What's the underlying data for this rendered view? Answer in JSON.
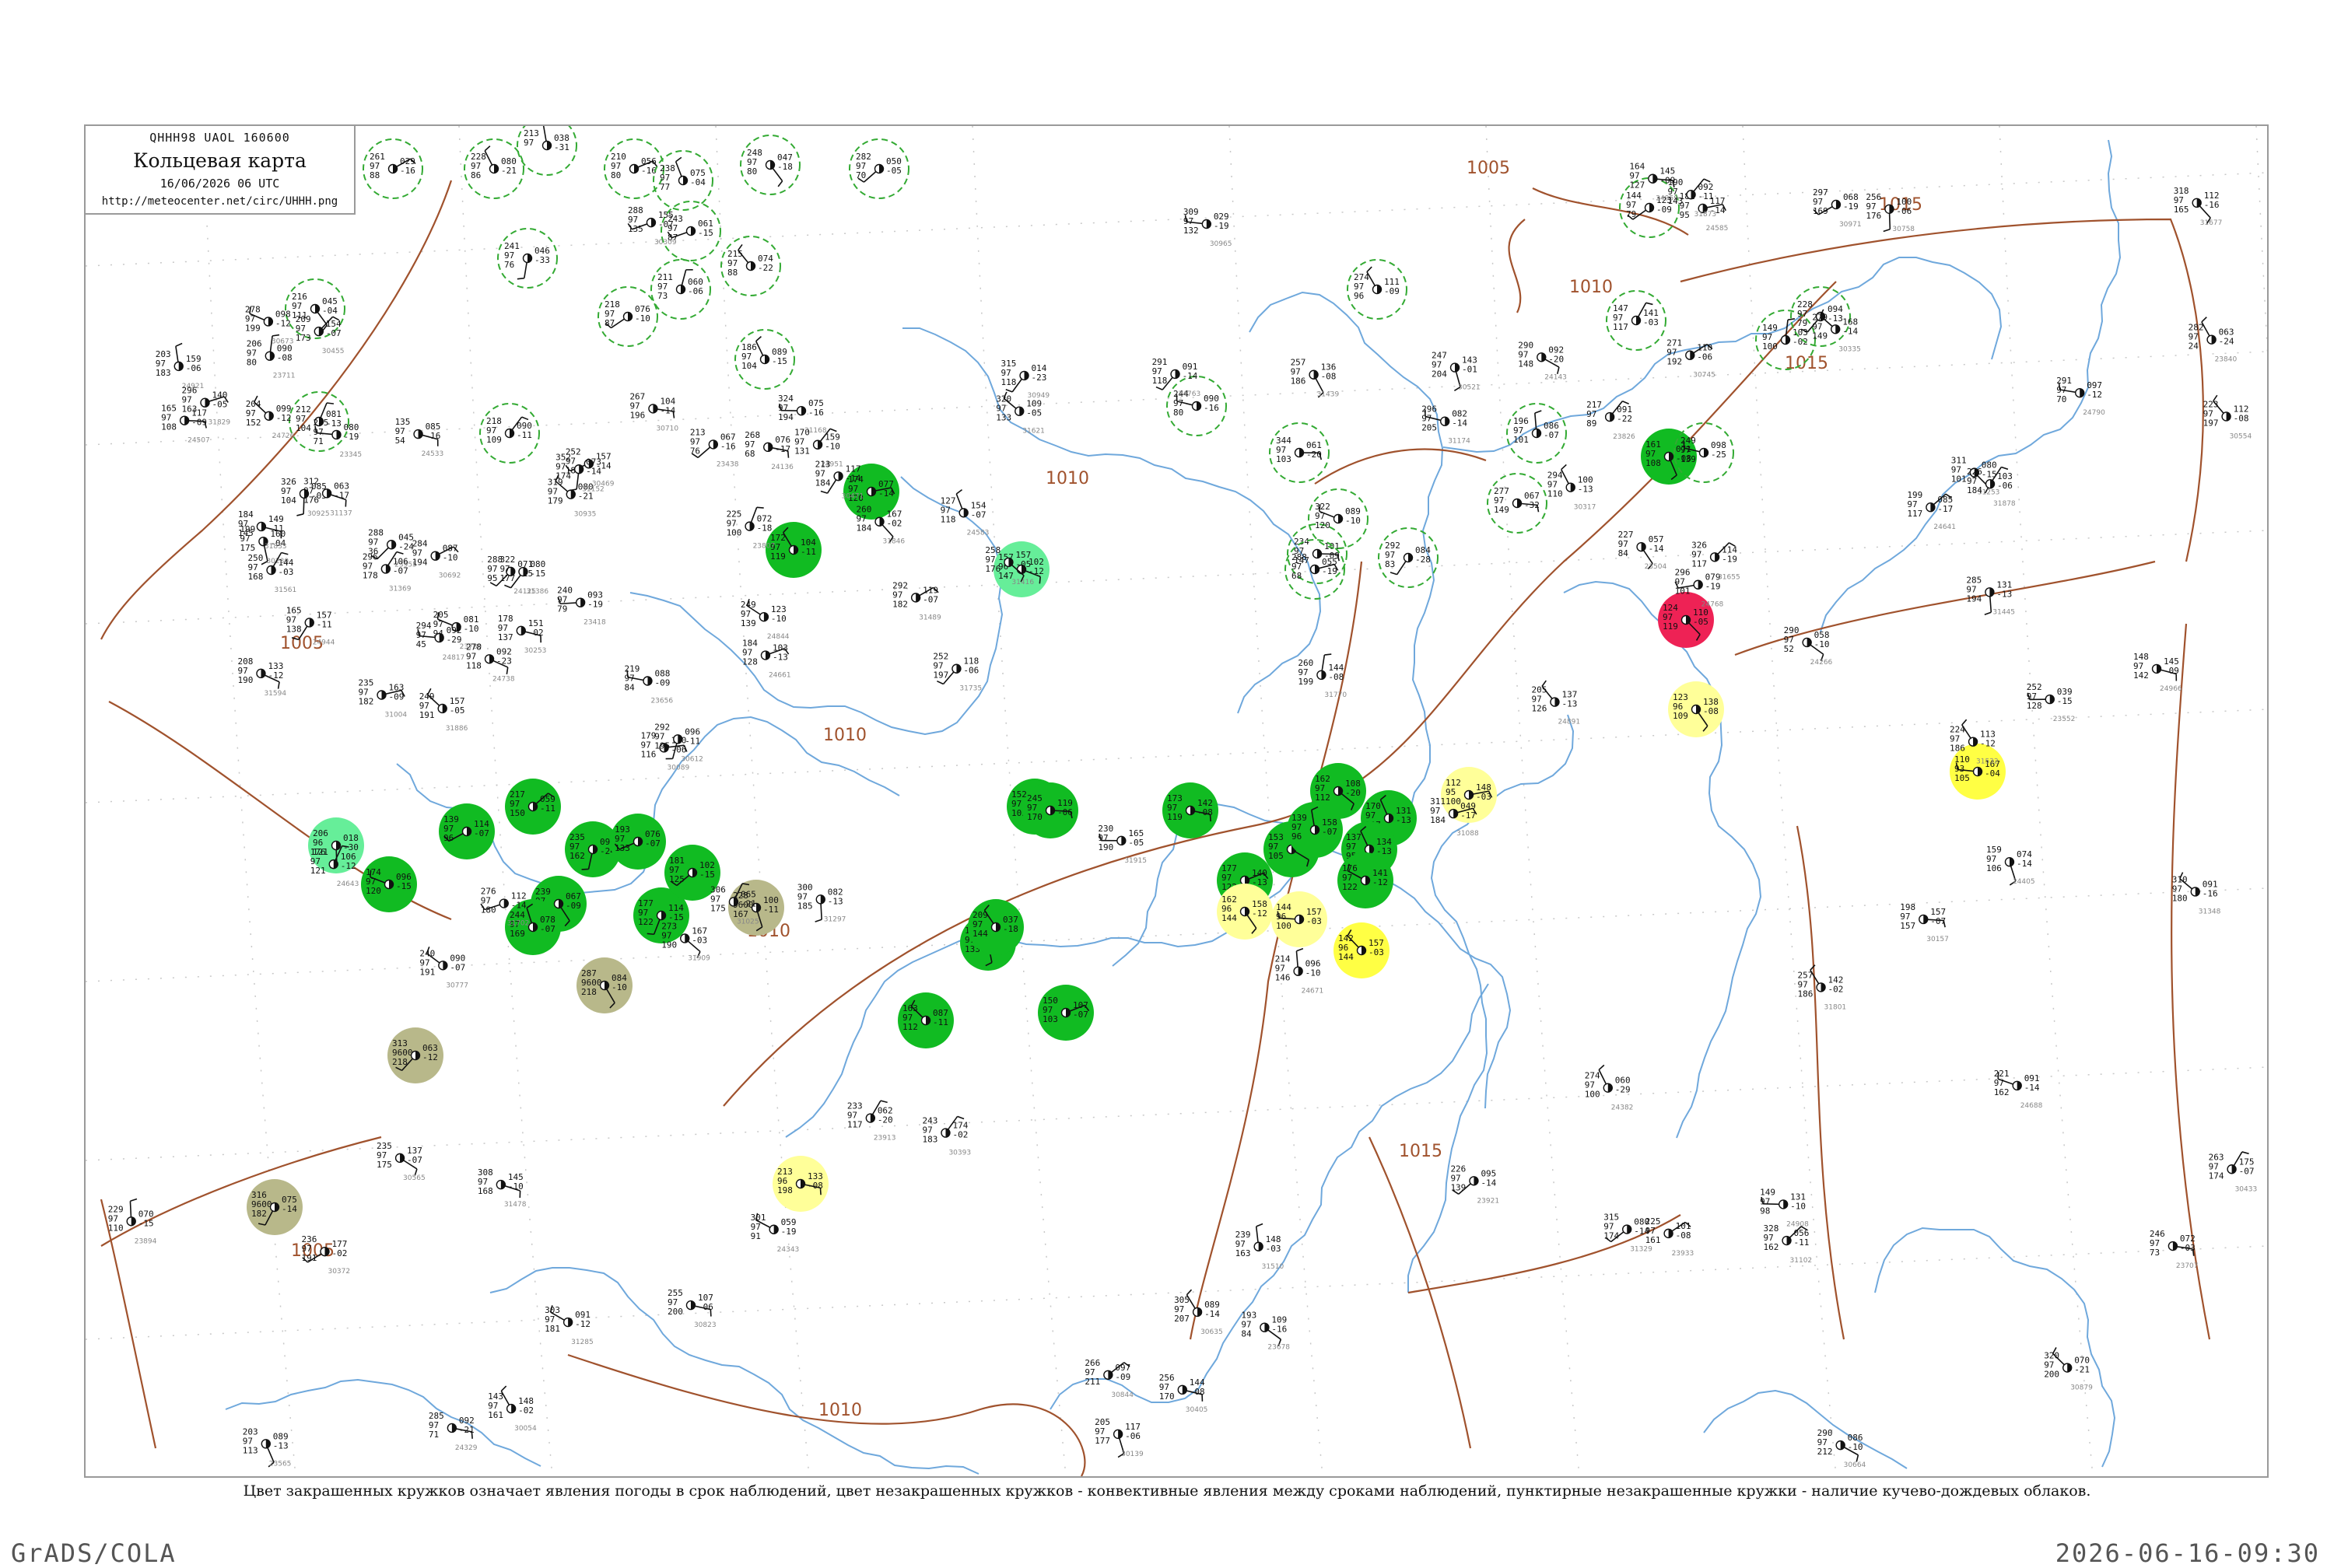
{
  "header": {
    "codes": "QHHH98  UAOL  160600",
    "title": "Кольцевая карта",
    "date": "16/06/2026 06 UTC",
    "url": "http://meteocenter.net/circ/UHHH.png"
  },
  "caption": "Цвет закрашенных кружков означает явления погоды в срок наблюдений, цвет незакрашенных кружков - конвективные явления между сроками наблюдений, пунктирные незакрашенные кружки - наличие кучево-дождевых облаков.",
  "footer": {
    "left": "GrADS/COLA",
    "right": "2026-06-16-09:30"
  },
  "colors": {
    "isobar": "#a0522d",
    "river": "#6fa8dc",
    "green_fill": "#11bb22",
    "light_green_fill": "#66ee99",
    "yellow_fill": "#ffff44",
    "pale_yellow_fill": "#ffff99",
    "olive_fill": "#b8b88a",
    "red_fill": "#ee2255",
    "cb_ring": "#33aa33"
  },
  "isobars": [
    {
      "label": "1005",
      "lx": 0.089,
      "ly": 0.387
    },
    {
      "label": "1005",
      "lx": 0.633,
      "ly": 0.035
    },
    {
      "label": "1010",
      "lx": 0.44,
      "ly": 0.265
    },
    {
      "label": "1010",
      "lx": 0.338,
      "ly": 0.455
    },
    {
      "label": "1010",
      "lx": 0.303,
      "ly": 0.6
    },
    {
      "label": "1010",
      "lx": 0.68,
      "ly": 0.123
    },
    {
      "label": "1015",
      "lx": 0.822,
      "ly": 0.062
    },
    {
      "label": "1015",
      "lx": 0.779,
      "ly": 0.18
    },
    {
      "label": "1015",
      "lx": 0.602,
      "ly": 0.763
    },
    {
      "label": "1010",
      "lx": 0.336,
      "ly": 0.955
    },
    {
      "label": "1005",
      "lx": 0.094,
      "ly": 0.837
    }
  ],
  "stations": {
    "filled": [
      {
        "c": "green",
        "t": "172 97 119",
        "p": "104 -11"
      },
      {
        "c": "green",
        "t": "161 97 108",
        "p": "071 -08"
      },
      {
        "c": "green",
        "t": "174 97 120",
        "p": "077 -14"
      },
      {
        "c": "green",
        "t": "217 97 150",
        "p": "059 -11"
      },
      {
        "c": "green",
        "t": "174 97 120",
        "p": "096 -15"
      },
      {
        "c": "green",
        "t": "239 97 165",
        "p": "067 -09"
      },
      {
        "c": "green",
        "t": "139 97 96",
        "p": "114 -07"
      },
      {
        "c": "green",
        "t": "244 97 169",
        "p": "078 -07"
      },
      {
        "c": "green",
        "t": "235 97 162",
        "p": "094 -24"
      },
      {
        "c": "green",
        "t": "193 97 133",
        "p": "076 -07"
      },
      {
        "c": "green",
        "t": "177 97 122",
        "p": "114 -15"
      },
      {
        "c": "green",
        "t": "181 97 125",
        "p": "102 -15"
      },
      {
        "c": "green",
        "t": "152 97 105",
        "p": "082 -16"
      },
      {
        "c": "green",
        "t": "245 97 170",
        "p": "119 -06"
      },
      {
        "c": "green",
        "t": "192 97 133",
        "p": "103 -14"
      },
      {
        "c": "green",
        "t": "163 97 112",
        "p": "087 -11"
      },
      {
        "c": "green",
        "t": "209 97 144",
        "p": "037 -18"
      },
      {
        "c": "green",
        "t": "173 97 119",
        "p": "142 -08"
      },
      {
        "c": "green",
        "t": "177 97 122",
        "p": "140 -13"
      },
      {
        "c": "green",
        "t": "153 97 105",
        "p": "110 -13"
      },
      {
        "c": "green",
        "t": "162 97 112",
        "p": "108 -20"
      },
      {
        "c": "green",
        "t": "139 97 96",
        "p": "158 -07"
      },
      {
        "c": "green",
        "t": "170 97 117",
        "p": "131 -13"
      },
      {
        "c": "green",
        "t": "137 97 95",
        "p": "134 -13"
      },
      {
        "c": "green",
        "t": "176 97 122",
        "p": "141 -12"
      },
      {
        "c": "green",
        "t": "150 97 103",
        "p": "107 -07"
      },
      {
        "c": "light_green",
        "t": "157 96 147",
        "p": "102 -12"
      },
      {
        "c": "light_green",
        "t": "206 96 121",
        "p": "018 -30"
      },
      {
        "c": "olive",
        "t": "287 9600 218",
        "p": "084 -10"
      },
      {
        "c": "olive",
        "t": "313 9600 218",
        "p": "063 -12"
      },
      {
        "c": "olive",
        "t": "316 9600 182",
        "p": "075 -14"
      },
      {
        "c": "olive",
        "t": "228 9600 167",
        "p": "100 -11"
      },
      {
        "c": "pale_yellow",
        "t": "213 96 198",
        "p": "133 -08"
      },
      {
        "c": "pale_yellow",
        "t": "162 96 144",
        "p": "158 -12"
      },
      {
        "c": "pale_yellow",
        "t": "144 96 100",
        "p": "157 -03"
      },
      {
        "c": "pale_yellow",
        "t": "112 95 100",
        "p": "148 -03"
      },
      {
        "c": "pale_yellow",
        "t": "123 96 109",
        "p": "138 -08"
      },
      {
        "c": "yellow",
        "t": "110 93 105",
        "p": "167 -04"
      },
      {
        "c": "yellow",
        "t": "142 96 144",
        "p": "157 -03"
      },
      {
        "c": "red",
        "t": "124 97 119",
        "p": "110 -05"
      }
    ],
    "dashed": [
      {
        "t": "261 97 88",
        "p": "029 -16"
      },
      {
        "t": "228 97 86",
        "p": "080 -21"
      },
      {
        "t": "213 97",
        "p": "038 -31"
      },
      {
        "t": "210 97 80",
        "p": "056 -16"
      },
      {
        "t": "238 97 77",
        "p": "075 -04"
      },
      {
        "t": "248 97 80",
        "p": "047 -18"
      },
      {
        "t": "282 97 70",
        "p": "050 -05"
      },
      {
        "t": "243 97 87",
        "p": "061 -15"
      },
      {
        "t": "241 97 76",
        "p": "046 -33"
      },
      {
        "t": "216 97 111",
        "p": "045 -04"
      },
      {
        "t": "218 97 87",
        "p": "076 -10"
      },
      {
        "t": "211 97 73",
        "p": "060 -06"
      },
      {
        "t": "215 97 88",
        "p": "074 -22"
      },
      {
        "t": "186 97 104",
        "p": "089 -15"
      },
      {
        "t": "212 97 104",
        "p": "081 -13"
      },
      {
        "t": "218 97 109",
        "p": "090 -11"
      },
      {
        "t": "244 97 80",
        "p": "090 -16"
      },
      {
        "t": "234 97 147",
        "p": "101 -09"
      },
      {
        "t": "292 97 83",
        "p": "084 -28"
      },
      {
        "t": "288 97 68",
        "p": "055 -19"
      },
      {
        "t": "274 97 96",
        "p": "111 -09"
      },
      {
        "t": "196 97 101",
        "p": "086 -07"
      },
      {
        "t": "147 97 117",
        "p": "141 -03"
      },
      {
        "t": "144 97 79",
        "p": "123 -09"
      },
      {
        "t": "149 97 100",
        "p": "103 -02"
      },
      {
        "t": "228 97 79",
        "p": "094 -13"
      },
      {
        "t": "249 97 139",
        "p": "098 -25"
      },
      {
        "t": "277 97 149",
        "p": "067 -32"
      },
      {
        "t": "322 97 120",
        "p": "089 -10"
      },
      {
        "t": "344 97 103",
        "p": "061 -20"
      }
    ],
    "plain": [
      {
        "t": "285 97 71",
        "p": "080 -19",
        "id": "23345"
      },
      {
        "t": "240 97 79",
        "p": "093 -19",
        "id": "23418"
      },
      {
        "t": "213 97 76",
        "p": "067 -16",
        "id": "23438"
      },
      {
        "t": "227 97 84",
        "p": "057 -14",
        "id": "23504"
      },
      {
        "t": "252 97 128",
        "p": "039 -15",
        "id": "23552"
      },
      {
        "t": "203 97 113",
        "p": "089 -13",
        "id": "23565"
      },
      {
        "t": "219 97 84",
        "p": "088 -09",
        "id": "23656"
      },
      {
        "t": "193 97 84",
        "p": "109 -16",
        "id": "23678"
      },
      {
        "t": "246 97 73",
        "p": "072 -03",
        "id": "23707"
      },
      {
        "t": "206 97 80",
        "p": "090 -08",
        "id": "23711"
      },
      {
        "t": "205 97 94",
        "p": "081 -10",
        "id": "23780"
      },
      {
        "t": "225 97 100",
        "p": "072 -18",
        "id": "23807"
      },
      {
        "t": "217 97 89",
        "p": "091 -22",
        "id": "23826"
      },
      {
        "t": "282 97 24",
        "p": "063 -24",
        "id": "23840"
      },
      {
        "t": "229 97 110",
        "p": "070 -15",
        "id": "23894"
      },
      {
        "t": "233 97 117",
        "p": "062 -20",
        "id": "23913"
      },
      {
        "t": "226 97 139",
        "p": "095 -14",
        "id": "23921"
      },
      {
        "t": "225 97 161",
        "p": "101 -08",
        "id": "23933"
      },
      {
        "t": "288 97 36",
        "p": "045 -24",
        "id": "23955"
      },
      {
        "t": "288 97 95",
        "p": "071 -15",
        "id": "24125"
      },
      {
        "t": "268 97 68",
        "p": "076 -17",
        "id": "24136"
      },
      {
        "t": "290 97 148",
        "p": "092 -20",
        "id": "24143"
      },
      {
        "t": "290 97 52",
        "p": "058 -10",
        "id": "24266"
      },
      {
        "t": "285 97 71",
        "p": "092 -21",
        "id": "24329"
      },
      {
        "t": "301 97 91",
        "p": "059 -19",
        "id": "24343"
      },
      {
        "t": "274 97 100",
        "p": "060 -29",
        "id": "24382"
      },
      {
        "t": "159 97 106",
        "p": "074 -14",
        "id": "24405"
      },
      {
        "t": "165 97 108",
        "p": "117 -09",
        "id": "24507"
      },
      {
        "t": "135 97 54",
        "p": "085 -16",
        "id": "24533"
      },
      {
        "t": "127 97 118",
        "p": "154 -07",
        "id": "24583"
      },
      {
        "t": "181 97 95",
        "p": "117 -14",
        "id": "24585"
      },
      {
        "t": "199 97 117",
        "p": "085 -17",
        "id": "24641"
      },
      {
        "t": "176 97 121",
        "p": "106 -12",
        "id": "24643"
      },
      {
        "t": "184 97 128",
        "p": "103 -13",
        "id": "24661"
      },
      {
        "t": "214 97 146",
        "p": "096 -10",
        "id": "24671"
      },
      {
        "t": "221 97 162",
        "p": "091 -14",
        "id": "24688"
      },
      {
        "t": "204 97 152",
        "p": "099 -12",
        "id": "24726"
      },
      {
        "t": "278 97 118",
        "p": "092 -23",
        "id": "24738"
      },
      {
        "t": "291 97 118",
        "p": "091 -14",
        "id": "24763"
      },
      {
        "t": "296 97 101",
        "p": "079 -19",
        "id": "24768"
      },
      {
        "t": "291 97 70",
        "p": "097 -12",
        "id": "24790"
      },
      {
        "t": "294 97 45",
        "p": "092 -29",
        "id": "24817"
      },
      {
        "t": "249 97 139",
        "p": "123 -10",
        "id": "24844"
      },
      {
        "t": "205 97 126",
        "p": "137 -13",
        "id": "24891"
      },
      {
        "t": "149 97 98",
        "p": "131 -10",
        "id": "24908"
      },
      {
        "t": "203 97 183",
        "p": "159 -06",
        "id": "24921"
      },
      {
        "t": "165 97 138",
        "p": "157 -11",
        "id": "24944"
      },
      {
        "t": "170 97 131",
        "p": "159 -10",
        "id": "24951"
      },
      {
        "t": "164 97 127",
        "p": "145 -09",
        "id": "24959"
      },
      {
        "t": "148 97 142",
        "p": "145 -09",
        "id": "24966"
      },
      {
        "t": "143 97 161",
        "p": "148 -02",
        "id": "30054"
      },
      {
        "t": "179 97 116",
        "p": "150 -06",
        "id": "30089"
      },
      {
        "t": "205 97 177",
        "p": "117 -06",
        "id": "30139"
      },
      {
        "t": "198 97 157",
        "p": "157 -07",
        "id": "30157"
      },
      {
        "t": "199 97 175",
        "p": "160 -04",
        "id": "30230"
      },
      {
        "t": "178 97 137",
        "p": "151 -02",
        "id": "30253"
      },
      {
        "t": "288 97 135",
        "p": "155 -07",
        "id": "30309"
      },
      {
        "t": "294 97 110",
        "p": "100 -13",
        "id": "30317"
      },
      {
        "t": "279 97 149",
        "p": "168 -14",
        "id": "30335"
      },
      {
        "t": "236 97 191",
        "p": "177 -02",
        "id": "30372"
      },
      {
        "t": "243 97 183",
        "p": "174 -02",
        "id": "30393"
      },
      {
        "t": "256 97 170",
        "p": "144 -08",
        "id": "30405"
      },
      {
        "t": "263 97 174",
        "p": "175 -07",
        "id": "30433"
      },
      {
        "t": "209 97 173",
        "p": "154 -07",
        "id": "30455"
      },
      {
        "t": "252 97 184",
        "p": "157 -14",
        "id": "30469"
      },
      {
        "t": "213 97 184",
        "p": "117 -14",
        "id": "30471"
      },
      {
        "t": "247 97 204",
        "p": "143 -01",
        "id": "30521"
      },
      {
        "t": "223 97 197",
        "p": "112 -08",
        "id": "30554"
      },
      {
        "t": "235 97 175",
        "p": "137 -07",
        "id": "30565"
      },
      {
        "t": "292 97 195",
        "p": "096 -11",
        "id": "30612"
      },
      {
        "t": "305 97 207",
        "p": "089 -14",
        "id": "30635"
      },
      {
        "t": "290 97 212",
        "p": "086 -10",
        "id": "30664"
      },
      {
        "t": "278 97 199",
        "p": "098 -12",
        "id": "30673"
      },
      {
        "t": "284 97 194",
        "p": "087 -10",
        "id": "30692"
      },
      {
        "t": "267 97 196",
        "p": "104 -14",
        "id": "30710"
      },
      {
        "t": "271 97 192",
        "p": "110 -06",
        "id": "30745"
      },
      {
        "t": "256 97 176",
        "p": "100 -06",
        "id": "30758"
      },
      {
        "t": "240 97 191",
        "p": "090 -07",
        "id": "30777"
      },
      {
        "t": "255 97 200",
        "p": "107 -06",
        "id": "30823"
      },
      {
        "t": "266 97 211",
        "p": "097 -09",
        "id": "30844"
      },
      {
        "t": "320 97 200",
        "p": "070 -21",
        "id": "30879"
      },
      {
        "t": "326 97 104",
        "p": "085 -05",
        "id": "30925"
      },
      {
        "t": "319 97 179",
        "p": "080 -21",
        "id": "30935"
      },
      {
        "t": "315 97 118",
        "p": "014 -23",
        "id": "30949"
      },
      {
        "t": "309 97 132",
        "p": "029 -19",
        "id": "30965"
      },
      {
        "t": "297 97 169",
        "p": "068 -19",
        "id": "30971"
      },
      {
        "t": "235 97 182",
        "p": "163 -09",
        "id": "31004"
      },
      {
        "t": "306 97 175",
        "p": "065 -21",
        "id": "31025"
      },
      {
        "t": "311 97 184",
        "p": "049 -17",
        "id": "31088"
      },
      {
        "t": "328 97 162",
        "p": "056 -11",
        "id": "31102"
      },
      {
        "t": "312 97 176",
        "p": "063 -17",
        "id": "31137"
      },
      {
        "t": "352 97 174",
        "p": "073 -14",
        "id": "31152"
      },
      {
        "t": "324 97 194",
        "p": "075 -16",
        "id": "31168"
      },
      {
        "t": "296 97 205",
        "p": "082 -14",
        "id": "31174"
      },
      {
        "t": "311 97 101",
        "p": "080 -15",
        "id": "31253"
      },
      {
        "t": "303 97 181",
        "p": "091 -12",
        "id": "31285"
      },
      {
        "t": "300 97 185",
        "p": "082 -13",
        "id": "31297"
      },
      {
        "t": "315 97 174",
        "p": "080 -14",
        "id": "31329"
      },
      {
        "t": "310 97 180",
        "p": "091 -16",
        "id": "31348"
      },
      {
        "t": "296 97 178",
        "p": "106 -07",
        "id": "31369"
      },
      {
        "t": "322 97 177",
        "p": "080 -15",
        "id": "31386"
      },
      {
        "t": "258 97 176",
        "p": "157 -05",
        "id": "31416"
      },
      {
        "t": "257 97 186",
        "p": "136 -08",
        "id": "31439"
      },
      {
        "t": "285 97 194",
        "p": "131 -13",
        "id": "31445"
      },
      {
        "t": "308 97 168",
        "p": "145 -10",
        "id": "31478"
      },
      {
        "t": "292 97 182",
        "p": "119 -07",
        "id": "31489"
      },
      {
        "t": "239 97 163",
        "p": "148 -03",
        "id": "31510"
      },
      {
        "t": "224 97 186",
        "p": "113 -12",
        "id": "31532"
      },
      {
        "t": "250 97 168",
        "p": "144 -03",
        "id": "31561"
      },
      {
        "t": "208 97 190",
        "p": "133 -12",
        "id": "31594"
      },
      {
        "t": "320 97 133",
        "p": "109 -05",
        "id": "31621"
      },
      {
        "t": "326 97 117",
        "p": "114 -19",
        "id": "31655"
      },
      {
        "t": "318 97 165",
        "p": "112 -16",
        "id": "31677"
      },
      {
        "t": "276 97 180",
        "p": "112 -14",
        "id": "31702"
      },
      {
        "t": "252 97 197",
        "p": "118 -06",
        "id": "31735"
      },
      {
        "t": "260 97 199",
        "p": "144 -08",
        "id": "31770"
      },
      {
        "t": "257 97 186",
        "p": "142 -02",
        "id": "31801"
      },
      {
        "t": "296 97 163",
        "p": "140 -05",
        "id": "31829"
      },
      {
        "t": "184 97 145",
        "p": "149 -11",
        "id": "31833"
      },
      {
        "t": "260 97 184",
        "p": "167 -02",
        "id": "31846"
      },
      {
        "t": "190 97 143",
        "p": "092 -11",
        "id": "31873"
      },
      {
        "t": "226 97 184",
        "p": "103 -06",
        "id": "31878"
      },
      {
        "t": "249 97 191",
        "p": "157 -05",
        "id": "31886"
      },
      {
        "t": "273 97 190",
        "p": "167 -03",
        "id": "31909"
      },
      {
        "t": "230 97 190",
        "p": "165 -05",
        "id": "31915"
      }
    ]
  }
}
